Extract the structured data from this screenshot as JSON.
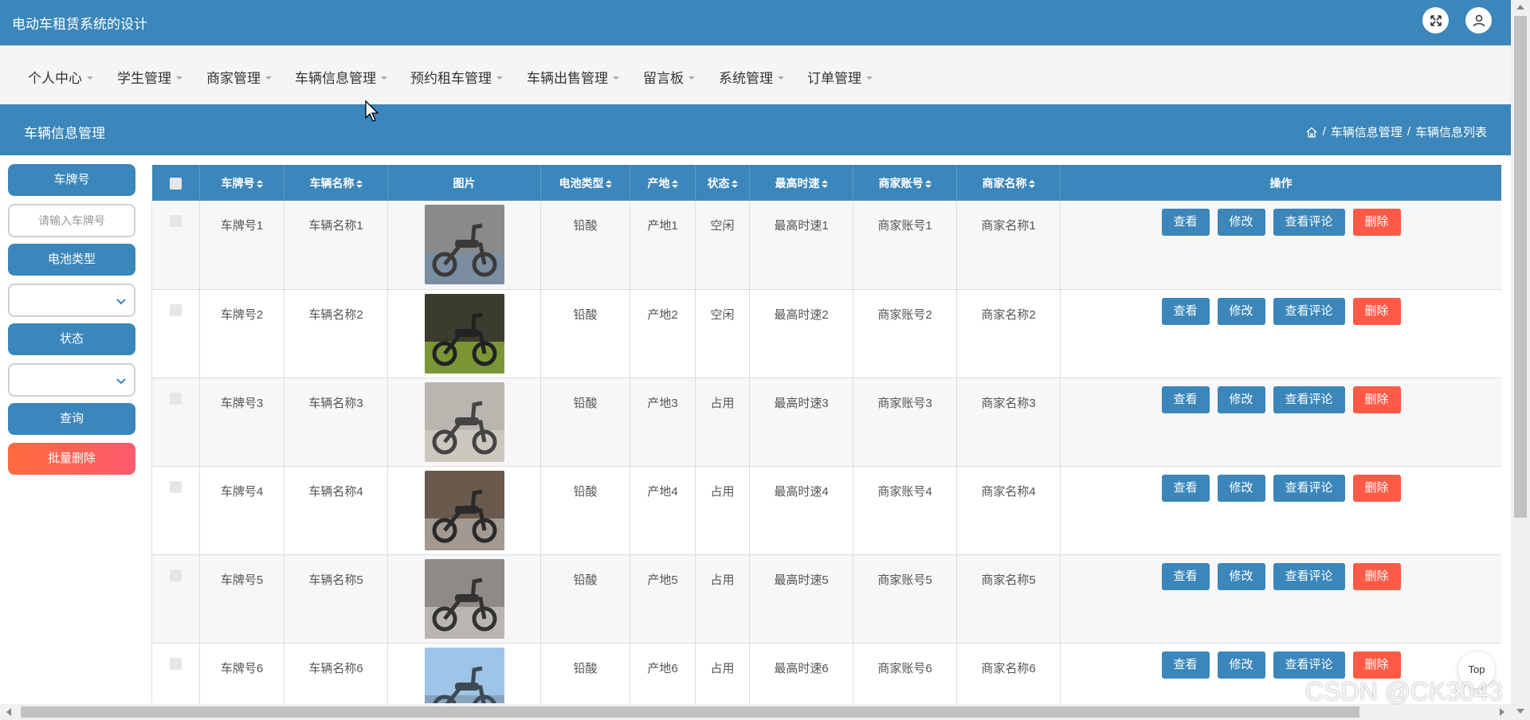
{
  "header": {
    "title": "电动车租赁系统的设计"
  },
  "nav": [
    {
      "label": "个人中心"
    },
    {
      "label": "学生管理"
    },
    {
      "label": "商家管理"
    },
    {
      "label": "车辆信息管理"
    },
    {
      "label": "预约租车管理"
    },
    {
      "label": "车辆出售管理"
    },
    {
      "label": "留言板"
    },
    {
      "label": "系统管理"
    },
    {
      "label": "订单管理"
    }
  ],
  "page": {
    "title": "车辆信息管理",
    "breadcrumb": [
      "车辆信息管理",
      "车辆信息列表"
    ],
    "separator": "/"
  },
  "filters": {
    "plate_label": "车牌号",
    "plate_placeholder": "请输入车牌号",
    "battery_label": "电池类型",
    "status_label": "状态",
    "query_button": "查询",
    "batch_delete_button": "批量删除"
  },
  "table": {
    "columns": [
      "车牌号",
      "车辆名称",
      "图片",
      "电池类型",
      "产地",
      "状态",
      "最高时速",
      "商家账号",
      "商家名称",
      "操作"
    ],
    "actions": {
      "view": "查看",
      "edit": "修改",
      "comment": "查看评论",
      "delete": "删除"
    },
    "rows": [
      {
        "plate": "车牌号1",
        "name": "车辆名称1",
        "battery": "铅酸",
        "origin": "产地1",
        "status": "空闲",
        "speed": "最高时速1",
        "account": "商家账号1",
        "merchant": "商家名称1"
      },
      {
        "plate": "车牌号2",
        "name": "车辆名称2",
        "battery": "铅酸",
        "origin": "产地2",
        "status": "空闲",
        "speed": "最高时速2",
        "account": "商家账号2",
        "merchant": "商家名称2"
      },
      {
        "plate": "车牌号3",
        "name": "车辆名称3",
        "battery": "铅酸",
        "origin": "产地3",
        "status": "占用",
        "speed": "最高时速3",
        "account": "商家账号3",
        "merchant": "商家名称3"
      },
      {
        "plate": "车牌号4",
        "name": "车辆名称4",
        "battery": "铅酸",
        "origin": "产地4",
        "status": "占用",
        "speed": "最高时速4",
        "account": "商家账号4",
        "merchant": "商家名称4"
      },
      {
        "plate": "车牌号5",
        "name": "车辆名称5",
        "battery": "铅酸",
        "origin": "产地5",
        "status": "占用",
        "speed": "最高时速5",
        "account": "商家账号5",
        "merchant": "商家名称5"
      },
      {
        "plate": "车牌号6",
        "name": "车辆名称6",
        "battery": "铅酸",
        "origin": "产地6",
        "status": "占用",
        "speed": "最高时速6",
        "account": "商家账号6",
        "merchant": "商家名称6"
      }
    ]
  },
  "top_button": "Top",
  "watermark": "CSDN @CK3043",
  "colors": {
    "primary": "#3b86ba",
    "danger": "#ff5a45",
    "nav_bg": "#f5f5f5"
  }
}
